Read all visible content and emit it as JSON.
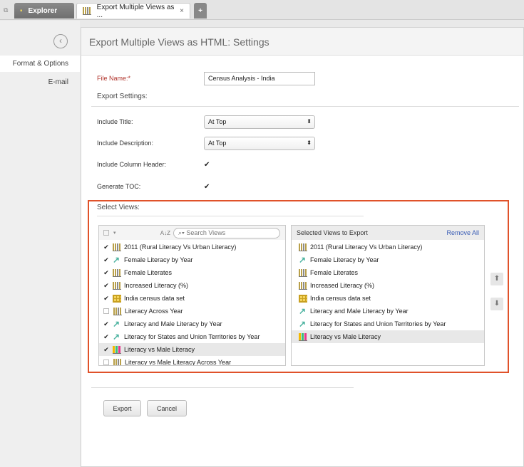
{
  "tabs": {
    "explorer": "Explorer",
    "export": "Export Multiple Views as ...",
    "close": "×",
    "add": "+"
  },
  "sidebar": {
    "items": [
      {
        "label": "Format & Options"
      },
      {
        "label": "E-mail"
      }
    ]
  },
  "header": {
    "title": "Export Multiple Views as HTML: Settings"
  },
  "form": {
    "file_name_label": "File Name:*",
    "file_name_value": "Census Analysis - India",
    "export_settings": "Export Settings:",
    "include_title_label": "Include Title:",
    "include_title_value": "At Top",
    "include_desc_label": "Include Description:",
    "include_desc_value": "At Top",
    "include_col_header_label": "Include Column Header:",
    "include_col_header_checked": true,
    "toc_label": "Generate TOC:",
    "toc_checked": true
  },
  "select_views": {
    "title": "Select Views:",
    "search_placeholder": "Search Views",
    "sort_icon": "A↓Z",
    "available": [
      {
        "label": "2011 (Rural Literacy Vs Urban Literacy)",
        "icon": "bar",
        "checked": true
      },
      {
        "label": "Female Literacy by Year",
        "icon": "arrow",
        "checked": true
      },
      {
        "label": "Female Literates",
        "icon": "bar",
        "checked": true
      },
      {
        "label": "Increased Literacy (%)",
        "icon": "bar",
        "checked": true
      },
      {
        "label": "India census data set",
        "icon": "grid",
        "checked": true
      },
      {
        "label": "Literacy Across Year",
        "icon": "bar",
        "checked": false
      },
      {
        "label": "Literacy and Male Literacy by Year",
        "icon": "arrow",
        "checked": true
      },
      {
        "label": "Literacy for States and Union Territories by Year",
        "icon": "arrow",
        "checked": true
      },
      {
        "label": "Literacy vs Male Literacy",
        "icon": "color",
        "checked": true,
        "highlighted": true
      },
      {
        "label": "Literacy vs Male Literacy Across Year",
        "icon": "bar",
        "checked": false
      }
    ],
    "selected_title": "Selected Views to Export",
    "remove_all": "Remove All",
    "selected": [
      {
        "label": "2011 (Rural Literacy Vs Urban Literacy)",
        "icon": "bar"
      },
      {
        "label": "Female Literacy by Year",
        "icon": "arrow"
      },
      {
        "label": "Female Literates",
        "icon": "bar"
      },
      {
        "label": "Increased Literacy (%)",
        "icon": "bar"
      },
      {
        "label": "India census data set",
        "icon": "grid"
      },
      {
        "label": "Literacy and Male Literacy by Year",
        "icon": "arrow"
      },
      {
        "label": "Literacy for States and Union Territories by Year",
        "icon": "arrow"
      },
      {
        "label": "Literacy vs Male Literacy",
        "icon": "color",
        "highlighted": true
      }
    ]
  },
  "buttons": {
    "export": "Export",
    "cancel": "Cancel"
  },
  "colors": {
    "highlight_border": "#e0522a",
    "link": "#3a5db5",
    "required_label": "#b0322a"
  }
}
